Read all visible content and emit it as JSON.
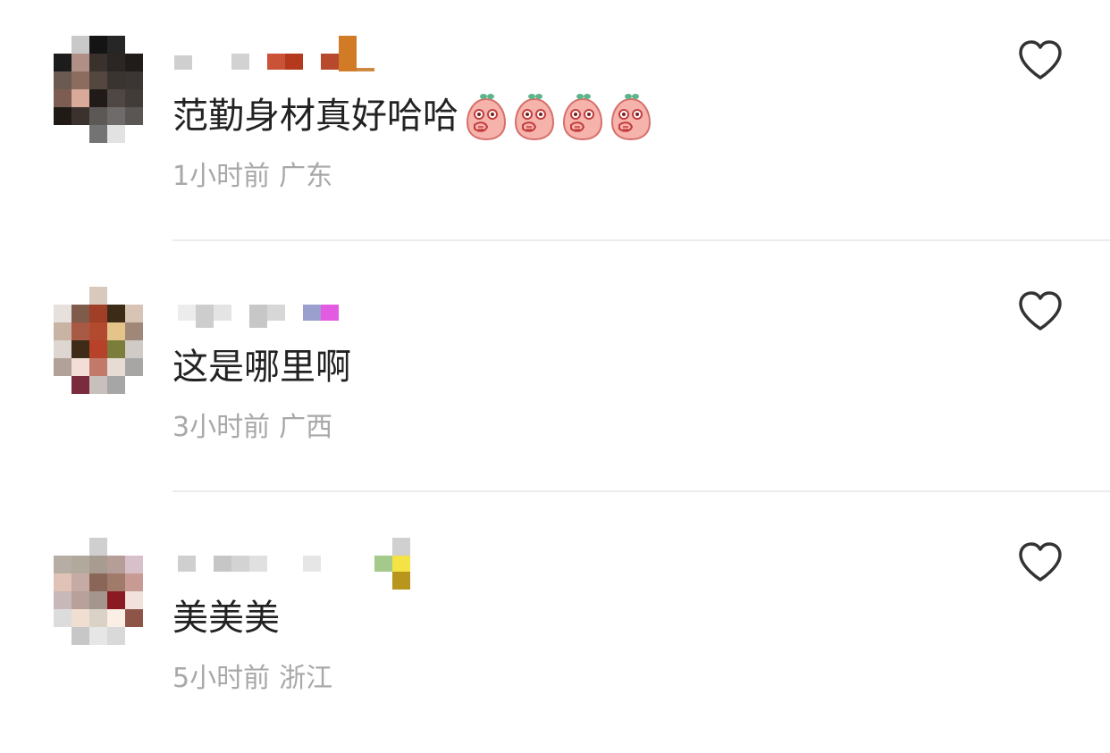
{
  "comments": [
    {
      "text": "范勤身材真好哈哈",
      "emoji_count": 4,
      "emoji_icon": "peach-covering-mouth-emoji",
      "time": "1小时前",
      "region": "广东"
    },
    {
      "text": "这是哪里啊",
      "emoji_count": 0,
      "time": "3小时前",
      "region": "广西"
    },
    {
      "text": "美美美",
      "emoji_count": 0,
      "time": "5小时前",
      "region": "浙江"
    }
  ],
  "like_icon": "heart-outline-icon",
  "colors": {
    "comment_text": "#222222",
    "meta_text": "#a8a8a8",
    "divider": "#ececec",
    "heart_stroke": "#333333",
    "emoji_fill": "#f6b3ab"
  }
}
